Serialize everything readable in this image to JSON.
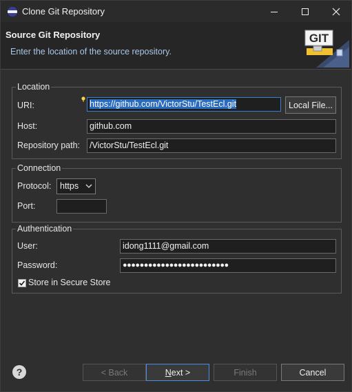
{
  "window": {
    "title": "Clone Git Repository",
    "minimize_icon": "minimize-icon",
    "maximize_icon": "maximize-icon",
    "close_icon": "close-icon"
  },
  "banner": {
    "title": "Source Git Repository",
    "description": "Enter the location of the source repository.",
    "logo_text": "GIT"
  },
  "location": {
    "legend": "Location",
    "uri_label": "URI:",
    "uri_value": "https://github.com/VictorStu/TestEcl.git",
    "local_file_button": "Local File...",
    "host_label": "Host:",
    "host_value": "github.com",
    "repo_path_label": "Repository path:",
    "repo_path_value": "/VictorStu/TestEcl.git"
  },
  "connection": {
    "legend": "Connection",
    "protocol_label": "Protocol:",
    "protocol_value": "https",
    "port_label": "Port:",
    "port_value": ""
  },
  "authentication": {
    "legend": "Authentication",
    "user_label": "User:",
    "user_value": "idong1111@gmail.com",
    "password_label": "Password:",
    "password_value": "●●●●●●●●●●●●●●●●●●●●●●●●●",
    "store_checkbox_label": "Store in Secure Store",
    "store_checked": true
  },
  "footer": {
    "help_icon": "help-icon",
    "back_button": "< Back",
    "next_button_prefix": "",
    "next_button_mnemonic": "N",
    "next_button_rest": "ext >",
    "finish_button": "Finish",
    "cancel_button": "Cancel"
  },
  "colors": {
    "background": "#2f2f2f",
    "banner": "#262626",
    "field": "#1f1f1f",
    "selection": "#2a6bbd",
    "focus_border": "#3c7fd1",
    "banner_desc": "#a9c8e6"
  }
}
